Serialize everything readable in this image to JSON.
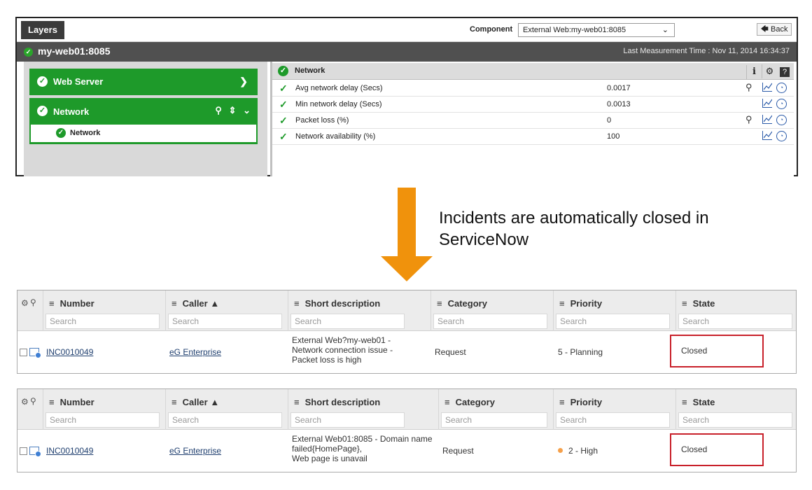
{
  "eg": {
    "layers_tab": "Layers",
    "component_label": "Component",
    "component_value": "External Web:my-web01:8085",
    "back_label": "Back",
    "host_name": "my-web01:8085",
    "last_measurement": "Last Measurement Time : Nov 11, 2014 16:34:37",
    "layers": [
      {
        "label": "Web Server"
      },
      {
        "label": "Network",
        "tests": [
          {
            "label": "Network"
          }
        ]
      }
    ],
    "measures_title": "Network",
    "measures": [
      {
        "name": "Avg network delay (Secs)",
        "value": "0.0017",
        "has_search": true
      },
      {
        "name": "Min network delay (Secs)",
        "value": "0.0013",
        "has_search": false
      },
      {
        "name": "Packet loss (%)",
        "value": "0",
        "has_search": true
      },
      {
        "name": "Network availability (%)",
        "value": "100",
        "has_search": false
      }
    ]
  },
  "caption": "Incidents are automatically closed in ServiceNow",
  "colors": {
    "status_green": "#1e9a2a",
    "arrow_orange": "#f0920c",
    "highlight_red": "#c8202a",
    "priority_orange": "#f5a04a"
  },
  "servicenow": {
    "columns": [
      "Number",
      "Caller ▲",
      "Short description",
      "Category",
      "Priority",
      "State"
    ],
    "search_placeholder": "Search",
    "tables": [
      {
        "number": "INC0010049",
        "caller": "eG Enterprise",
        "short_description": [
          "External Web?my-web01 -",
          "Network connection issue -",
          "Packet loss is high"
        ],
        "category": "Request",
        "priority": "5 - Planning",
        "state": "Closed"
      },
      {
        "number": "INC0010049",
        "caller": "eG Enterprise",
        "short_description": [
          "External Web01:8085 - Domain name",
          "failed{HomePage},",
          "Web page is unavail"
        ],
        "category": "Request",
        "priority": "2 - High",
        "state": "Closed"
      }
    ]
  }
}
